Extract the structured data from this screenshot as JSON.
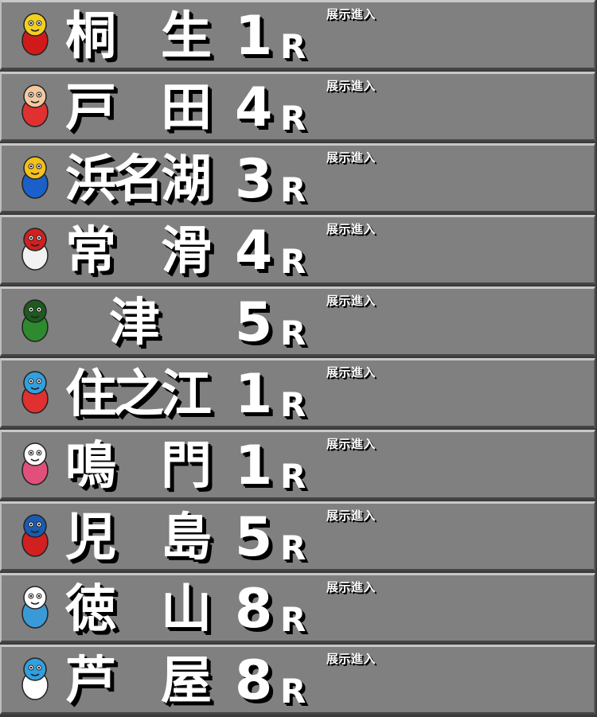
{
  "rows": [
    {
      "chars": [
        "桐",
        "生"
      ],
      "race": "1",
      "r": "R",
      "tag": "展示進入",
      "mascot": "mascot-kiryu-icon",
      "colors": [
        "#d01a1a",
        "#f2d020"
      ]
    },
    {
      "chars": [
        "戸",
        "田"
      ],
      "race": "4",
      "r": "R",
      "tag": "展示進入",
      "mascot": "mascot-toda-icon",
      "colors": [
        "#e03030",
        "#f5c8a0"
      ]
    },
    {
      "chars": [
        "浜",
        "名",
        "湖"
      ],
      "race": "3",
      "r": "R",
      "tag": "展示進入",
      "mascot": "mascot-hamanako-icon",
      "colors": [
        "#1a60c8",
        "#f4c01a"
      ]
    },
    {
      "chars": [
        "常",
        "滑"
      ],
      "race": "4",
      "r": "R",
      "tag": "展示進入",
      "mascot": "mascot-tokoname-icon",
      "colors": [
        "#f2f2f2",
        "#d02020"
      ]
    },
    {
      "chars": [
        "津"
      ],
      "race": "5",
      "r": "R",
      "tag": "展示進入",
      "mascot": "mascot-tsu-icon",
      "colors": [
        "#2e8a2e",
        "#1e5a1e"
      ]
    },
    {
      "chars": [
        "住",
        "之",
        "江"
      ],
      "race": "1",
      "r": "R",
      "tag": "展示進入",
      "mascot": "mascot-suminoe-icon",
      "colors": [
        "#e03030",
        "#30a0e0"
      ]
    },
    {
      "chars": [
        "鳴",
        "門"
      ],
      "race": "1",
      "r": "R",
      "tag": "展示進入",
      "mascot": "mascot-naruto-icon",
      "colors": [
        "#e0507a",
        "#ffffff"
      ]
    },
    {
      "chars": [
        "児",
        "島"
      ],
      "race": "5",
      "r": "R",
      "tag": "展示進入",
      "mascot": "mascot-kojima-icon",
      "colors": [
        "#d02020",
        "#1a5ab0"
      ]
    },
    {
      "chars": [
        "徳",
        "山"
      ],
      "race": "8",
      "r": "R",
      "tag": "展示進入",
      "mascot": "mascot-tokuyama-icon",
      "colors": [
        "#3a9ad8",
        "#ffffff"
      ]
    },
    {
      "chars": [
        "芦",
        "屋"
      ],
      "race": "8",
      "r": "R",
      "tag": "展示進入",
      "mascot": "mascot-ashiya-icon",
      "colors": [
        "#ffffff",
        "#30a0e0"
      ]
    }
  ]
}
